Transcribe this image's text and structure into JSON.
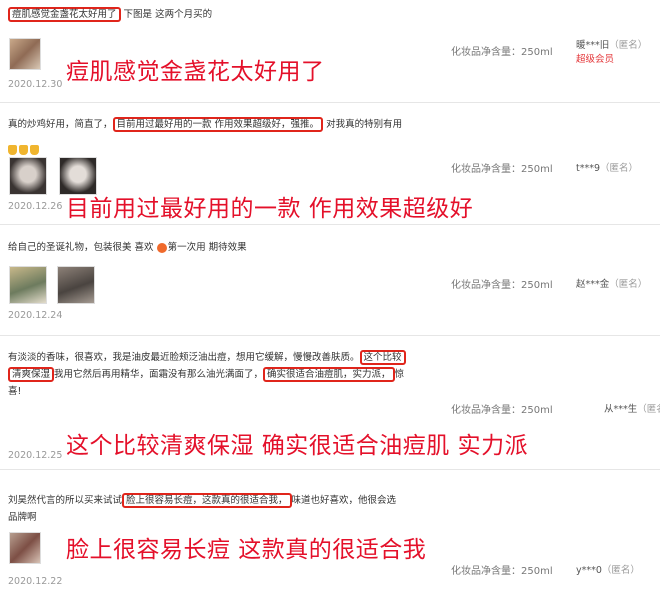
{
  "reviews": [
    {
      "text_hl": "痘肌感觉金盏花太好用了",
      "text_rest": "下图是 这两个月买的",
      "spec": "化妆品净含量：250ml",
      "user": "暖***旧",
      "anon": "（匿名）",
      "badge": "超级会员",
      "date": "2020.12.30",
      "annotation": "痘肌感觉金盏花太好用了"
    },
    {
      "text_pre": "真的炒鸡好用，简直了，",
      "text_hl": "目前用过最好用的一款 作用效果超级好，强推。",
      "text_post": "对我真的特别有用",
      "spec": "化妆品净含量：250ml",
      "user": "t***9",
      "anon": "（匿名）",
      "date": "2020.12.26",
      "annotation": "目前用过最好用的一款 作用效果超级好"
    },
    {
      "text_pre": "给自己的圣诞礼物，包装很美 喜欢",
      "text_post": "第一次用 期待效果",
      "spec": "化妆品净含量：250ml",
      "user": "赵***金",
      "anon": "（匿名）",
      "date": "2020.12.24"
    },
    {
      "line1_pre": "有淡淡的香味，很喜欢，我是油皮最近脸颊泛油出痘，想用它缓解，慢慢改善肤质。",
      "line1_hl": "这个比较",
      "line2_hl": "清爽保湿",
      "line2_mid": "我用它然后再用精华，面霜没有那么油光满面了，",
      "line2_hl2": "确实很适合油痘肌，实力派，",
      "line2_post": "惊",
      "line3": "喜!",
      "spec": "化妆品净含量：250ml",
      "user": "从***生",
      "anon": "（匿名）",
      "date": "2020.12.25",
      "annotation": "这个比较清爽保湿 确实很适合油痘肌 实力派"
    },
    {
      "line1_pre": "刘昊然代言的所以买来试试",
      "line1_hl": "脸上很容易长痘，这款真的很适合我，",
      "line1_post": "味道也好喜欢，他很会选",
      "line2": "品牌啊",
      "spec": "化妆品净含量：250ml",
      "user": "y***0",
      "anon": "（匿名）",
      "date": "2020.12.22",
      "annotation": "脸上很容易长痘 这款真的很适合我"
    }
  ],
  "colors": {
    "highlight": "#e0251b",
    "annotation": "#e4102a",
    "member": "#e4393c"
  }
}
